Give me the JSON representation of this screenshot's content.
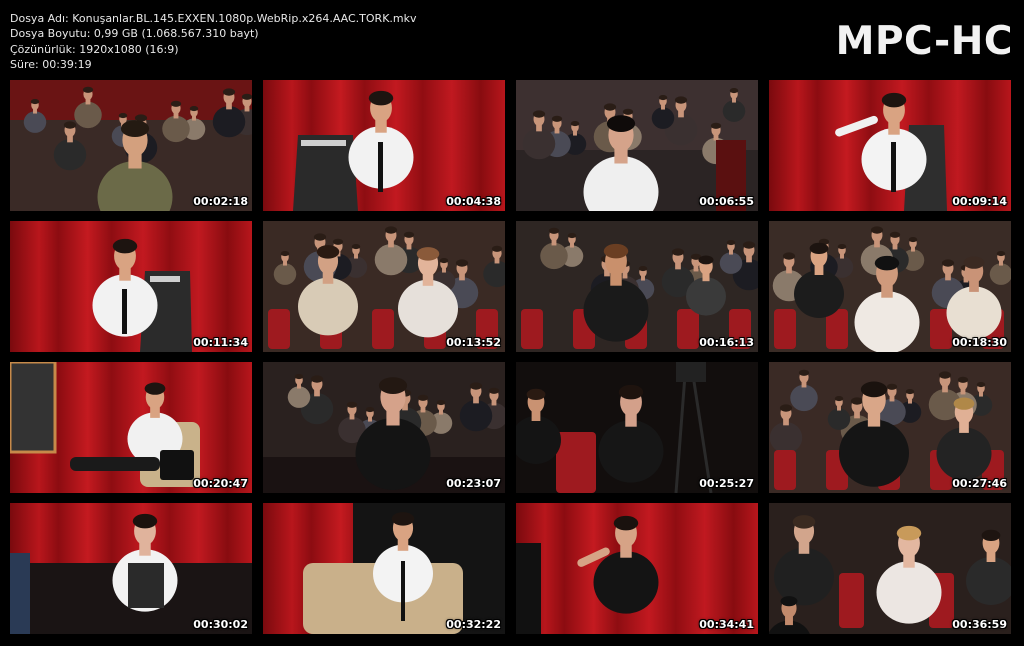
{
  "file_info": {
    "name_line": "Dosya Adı: Konuşanlar.BL.145.EXXEN.1080p.WebRip.x264.AAC.TORK.mkv",
    "size_line": "Dosya Boyutu: 0,99 GB (1.068.567.310 bayt)",
    "resolution_line": "Çözünürlük: 1920x1080 (16:9)",
    "duration_line": "Süre: 00:39:19"
  },
  "logo": "MPC-HC",
  "thumbnails": [
    {
      "time": "00:02:18",
      "scene": "audience-man"
    },
    {
      "time": "00:04:38",
      "scene": "host-curtain"
    },
    {
      "time": "00:06:55",
      "scene": "woman-brooklyn"
    },
    {
      "time": "00:09:14",
      "scene": "host-gesture"
    },
    {
      "time": "00:11:34",
      "scene": "host-seated"
    },
    {
      "time": "00:13:52",
      "scene": "audience-women"
    },
    {
      "time": "00:16:13",
      "scene": "woman-curly"
    },
    {
      "time": "00:18:30",
      "scene": "audience-row"
    },
    {
      "time": "00:20:47",
      "scene": "host-chair"
    },
    {
      "time": "00:23:07",
      "scene": "woman-laugh"
    },
    {
      "time": "00:25:27",
      "scene": "woman-camera"
    },
    {
      "time": "00:27:46",
      "scene": "audience-smile"
    },
    {
      "time": "00:30:02",
      "scene": "woman-vest"
    },
    {
      "time": "00:32:22",
      "scene": "host-armchair"
    },
    {
      "time": "00:34:41",
      "scene": "man-standing"
    },
    {
      "time": "00:36:59",
      "scene": "woman-blonde"
    }
  ],
  "colors": {
    "curtain": "#b8161c",
    "background": "#000000"
  }
}
